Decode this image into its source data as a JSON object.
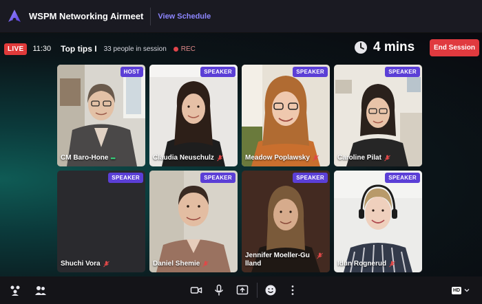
{
  "app": {
    "event_title": "WSPM Networking Airmeet",
    "view_schedule": "View Schedule"
  },
  "session": {
    "live_label": "LIVE",
    "clock": "11:30",
    "title": "Top tips I",
    "people": "33 people in session",
    "rec_label": "REC",
    "timer": "4 mins",
    "end_label": "End Session"
  },
  "tiles": [
    {
      "name": "CM Baro-Hone",
      "role": "HOST",
      "mic": "active"
    },
    {
      "name": "Claudia Neuschulz",
      "role": "SPEAKER",
      "mic": "muted"
    },
    {
      "name": "Meadow Poplawsky",
      "role": "SPEAKER",
      "mic": "muted"
    },
    {
      "name": "Caroline Pilat",
      "role": "SPEAKER",
      "mic": "muted"
    },
    {
      "name": "Shuchi Vora",
      "role": "SPEAKER",
      "mic": "muted"
    },
    {
      "name": "Daniel Shemie",
      "role": "SPEAKER",
      "mic": "muted"
    },
    {
      "name": "Jennifer Moeller-Gu lland",
      "role": "SPEAKER",
      "mic": "muted"
    },
    {
      "name": "Idun Rognerud",
      "role": "SPEAKER",
      "mic": "muted"
    }
  ],
  "toolbar": {
    "left_icons": [
      "people-network-icon",
      "participants-icon"
    ],
    "center_icons": [
      "camera-icon",
      "microphone-icon",
      "share-screen-icon",
      "emoji-icon",
      "more-options-icon"
    ],
    "quality_label": "HD"
  },
  "colors": {
    "accent": "#5b3fd6",
    "live_red": "#e03a3a",
    "link": "#8d86ff",
    "speaking_green": "#38d27c"
  }
}
